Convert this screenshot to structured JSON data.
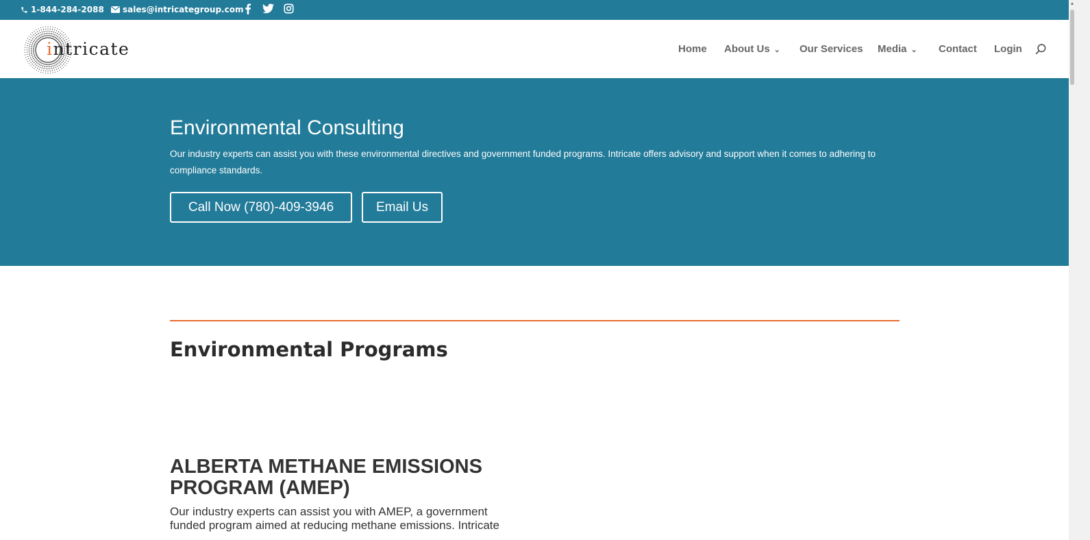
{
  "topbar": {
    "phone": "1-844-284-2088",
    "email": "sales@intricategroup.com",
    "social_icons": [
      "facebook-icon",
      "twitter-icon",
      "instagram-icon"
    ]
  },
  "header": {
    "logo_text_accent": "i",
    "logo_text_rest": "ntricate",
    "nav": [
      {
        "label": "Home"
      },
      {
        "label": "About Us",
        "has_dropdown": true
      },
      {
        "label": "Our Services"
      },
      {
        "label": "Media",
        "has_dropdown": true
      },
      {
        "label": "Contact"
      },
      {
        "label": "Login"
      }
    ]
  },
  "hero": {
    "title": "Environmental Consulting",
    "description": "Our industry experts can assist you with these environmental directives and government funded programs. Intricate offers advisory and support when it comes to adhering to compliance standards.",
    "call_button": "Call Now (780)-409-3946",
    "email_button": "Email Us"
  },
  "content": {
    "section_title": "Environmental Programs",
    "program_title": "ALBERTA METHANE EMISSIONS PROGRAM (AMEP)",
    "program_text": "Our industry experts can assist you with AMEP, a government funded program aimed at reducing methane emissions. Intricate"
  },
  "colors": {
    "brand_teal": "#227b99",
    "accent_orange": "#e86a2e",
    "nav_text": "#666666"
  }
}
